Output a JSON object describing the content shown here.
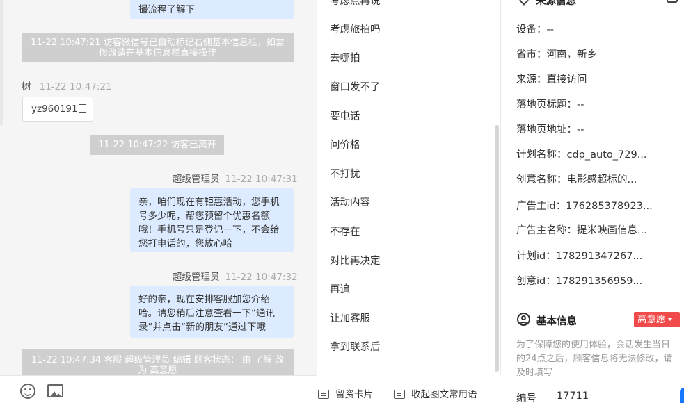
{
  "chat": {
    "top_bubble": "撮流程了解下",
    "sys_wechat": "11-22 10:47:21 访客微信号已自动标记右侧基本信息栏，如需修改请在基本信息栏直接操作",
    "visitor_name": "树",
    "visitor_time": "11-22 10:47:21",
    "wechat_id": "yz960191",
    "sys_left": "11-22 10:47:22 访客已离开",
    "messages": [
      {
        "sender": "超级管理员",
        "time": "11-22 10:47:31",
        "text": "亲，咱们现在有钜惠活动，您手机号多少呢，帮您预留个优惠名额哦！手机号只是登记一下，不会给您打电话的，您放心哈"
      },
      {
        "sender": "超级管理员",
        "time": "11-22 10:47:32",
        "text": "好的亲，现在安排客服加您介绍哈。请您稍后注意查看一下“通讯录”并点击“新的朋友”通过下哦"
      }
    ],
    "sys_status": "11-22 10:47:34 客服 超级管理员 编辑 顾客状态： 由 了解 改为 高意愿"
  },
  "phrases": {
    "top_partial": "考虑点再说",
    "items": [
      "考虑旅拍吗",
      "去哪拍",
      "窗口发不了",
      "要电话",
      "问价格",
      "不打扰",
      "活动内容",
      "不存在",
      "对比再决定",
      "再追",
      "让加客服",
      "拿到联系后"
    ]
  },
  "toolbar": {
    "card_label": "留资卡片",
    "collapse_label": "收起图文常用语"
  },
  "source": {
    "title": "来源信息",
    "rows": [
      "设备：--",
      "省市：河南，新乡",
      "来源：直接访问",
      "落地页标题：--",
      "落地页地址：--",
      "计划名称：cdp_auto_729...",
      "创意名称：电影感超标的...",
      "广告主id：176285378923...",
      "广告主名称：提米映画信息...",
      "计划id：178291347267...",
      "创意id：178291356959..."
    ]
  },
  "basic": {
    "title": "基本信息",
    "intent": "高意愿",
    "notice": "为了保障您的使用体验，会话发生当日的24点之后，顾客信息将无法修改，请及时填写",
    "id_label": "编号",
    "id_value": "17711"
  },
  "colors": {
    "bubble": "#dcebff",
    "system_note": "#cfcfcf",
    "intent_badge": "#f04a4a",
    "accent": "#1677ff"
  }
}
